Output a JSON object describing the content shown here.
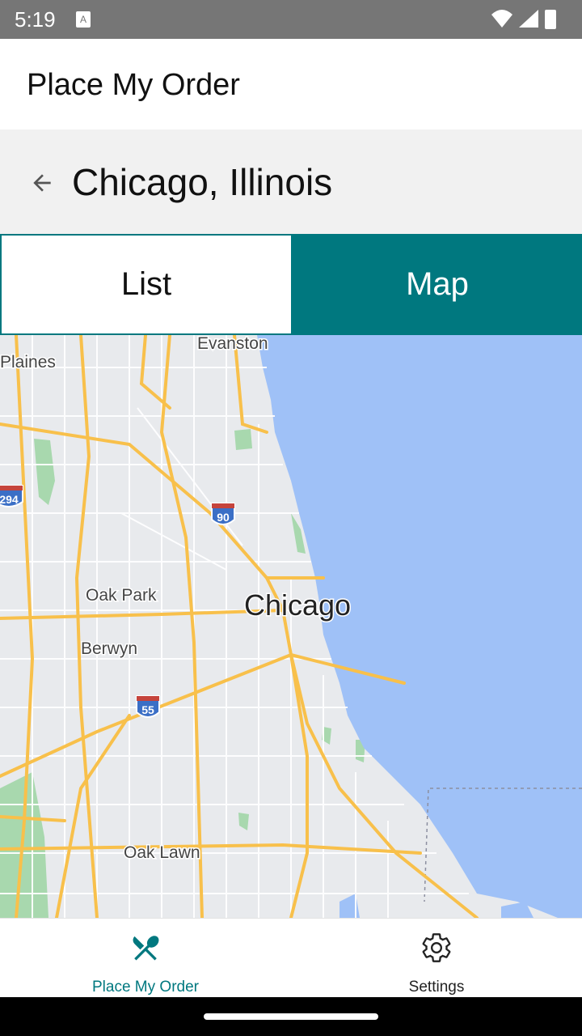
{
  "status_bar": {
    "time": "5:19"
  },
  "app_bar": {
    "title": "Place My Order"
  },
  "sub_header": {
    "title": "Chicago, Illinois"
  },
  "tabs": [
    {
      "label": "List",
      "selected": false
    },
    {
      "label": "Map",
      "selected": true
    }
  ],
  "map": {
    "labels": {
      "evanston": "Evanston",
      "des_plaines": "Plaines",
      "oak_park": "Oak Park",
      "chicago": "Chicago",
      "berwyn": "Berwyn",
      "oak_lawn": "Oak Lawn"
    },
    "shields": {
      "i90": "90",
      "i294": "294",
      "i55": "55"
    }
  },
  "bottom_nav": [
    {
      "label": "Place My Order",
      "icon": "fork-knife-icon",
      "active": true
    },
    {
      "label": "Settings",
      "icon": "gear-icon",
      "active": false
    }
  ],
  "colors": {
    "accent": "#00787f",
    "water": "#9fc1f7",
    "highway": "#f8c04b",
    "park": "#a8d8ae"
  }
}
